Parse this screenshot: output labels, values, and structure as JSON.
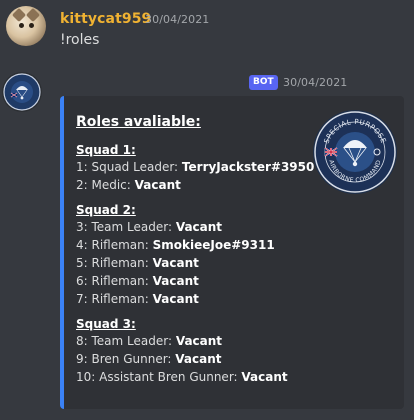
{
  "message1": {
    "username": "kittycat959",
    "timestamp": "30/04/2021",
    "content": "!roles"
  },
  "message2": {
    "badge": "BOT",
    "timestamp": "30/04/2021",
    "embed": {
      "accent_color": "#3b82f6",
      "title": "Roles avaliable:",
      "thumbnail_text_top": "SPECIAL PURPOSE",
      "thumbnail_text_bottom": "AIRBORNE COMMAND",
      "squads": [
        {
          "heading": "Squad 1:",
          "roles": [
            {
              "label": "1: Squad Leader: ",
              "value": "TerryJackster#3950"
            },
            {
              "label": "2: Medic: ",
              "value": "Vacant"
            }
          ]
        },
        {
          "heading": "Squad 2:",
          "roles": [
            {
              "label": "3: Team Leader: ",
              "value": "Vacant"
            },
            {
              "label": "4: Rifleman: ",
              "value": "SmokieeJoe#9311"
            },
            {
              "label": "5: Rifleman: ",
              "value": "Vacant"
            },
            {
              "label": "6: Rifleman: ",
              "value": "Vacant"
            },
            {
              "label": "7: Rifleman: ",
              "value": "Vacant"
            }
          ]
        },
        {
          "heading": "Squad 3:",
          "roles": [
            {
              "label": "8: Team Leader: ",
              "value": "Vacant"
            },
            {
              "label": "9: Bren Gunner: ",
              "value": "Vacant"
            },
            {
              "label": "10: Assistant Bren Gunner: ",
              "value": "Vacant"
            }
          ]
        }
      ]
    }
  },
  "colors": {
    "background": "#36393f",
    "username": "#f0b232",
    "bot_badge": "#5865f2",
    "embed_bg": "#2f3136"
  }
}
